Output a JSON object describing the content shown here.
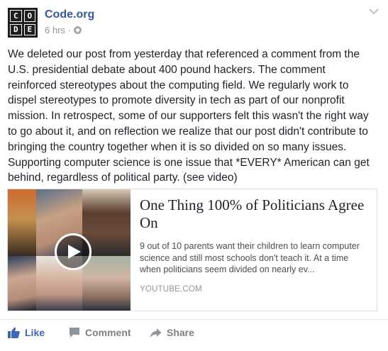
{
  "post": {
    "page_name": "Code.org",
    "logo_letters": [
      "C",
      "O",
      "D",
      "E"
    ],
    "timestamp": "6 hrs",
    "separator": "·",
    "privacy_icon": "globe-icon",
    "text": "We deleted our post from yesterday that referenced a comment from the U.S. presidential debate about 400 pound hackers. The comment reinforced stereotypes about the computing field. We regularly work to dispel stereotypes to promote diversity in tech as part of our nonprofit mission. In retrospect, some of our supporters felt this wasn't the right way to go about it, and on reflection we realize that our post didn't contribute to bringing the country together when it is so divided on so many issues. Supporting computer science is one issue that *EVERY* American can get behind, regardless of political party. (see video)"
  },
  "link_preview": {
    "title": "One Thing 100% of Politicians Agree On",
    "description": "9 out of 10 parents want their children to learn computer science and still most schools don't teach it. At a time when politicians seem divided on nearly ev...",
    "source": "YOUTUBE.COM",
    "thumbnail_icon": "play-icon"
  },
  "actions": {
    "like": "Like",
    "comment": "Comment",
    "share": "Share"
  },
  "colors": {
    "link_blue": "#365899",
    "like_blue": "#4267b2",
    "muted_gray": "#90949c"
  }
}
